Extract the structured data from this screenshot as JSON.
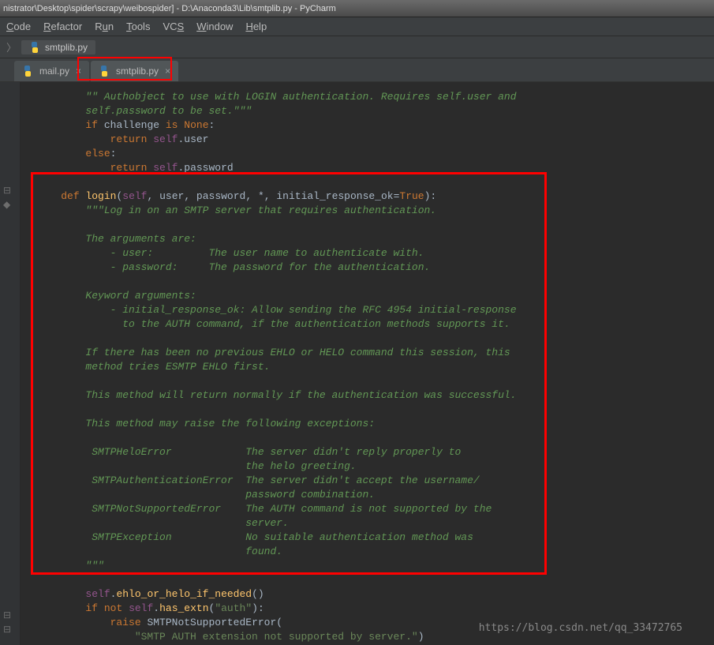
{
  "title": "nistrator\\Desktop\\spider\\scrapy\\weibospider] - D:\\Anaconda3\\Lib\\smtplib.py - PyCharm",
  "menu": {
    "code": "Code",
    "refactor": "Refactor",
    "run": "Run",
    "tools": "Tools",
    "vcs": "VCS",
    "window": "Window",
    "help": "Help"
  },
  "crumb": {
    "label": "smtplib.py",
    "arrow": "〉"
  },
  "tabs": [
    {
      "label": "mail.py"
    },
    {
      "label": "smtplib.py"
    }
  ],
  "watermark": "https://blog.csdn.net/qq_33472765",
  "code": {
    "doc1a": "\"\" Authobject to use with LOGIN authentication. Requires self.user and",
    "doc1b": "self.password to be set.\"\"\"",
    "if": "if",
    "challenge": "challenge",
    "is": "is",
    "None": "None",
    "return": "return",
    "self": "self",
    "user": "user",
    "password": "password",
    "else": "else",
    "def": "def",
    "login": "login",
    "args": "self, user, password, *, initial_response_ok=",
    "True": "True",
    "docstring": "\"\"\"Log in on an SMTP server that requires authentication.\n\nThe arguments are:\n    - user:         The user name to authenticate with.\n    - password:     The password for the authentication.\n\nKeyword arguments:\n    - initial_response_ok: Allow sending the RFC 4954 initial-response\n      to the AUTH command, if the authentication methods supports it.\n\nIf there has been no previous EHLO or HELO command this session, this\nmethod tries ESMTP EHLO first.\n\nThis method will return normally if the authentication was successful.\n\nThis method may raise the following exceptions:\n\n SMTPHeloError            The server didn't reply properly to\n                          the helo greeting.\n SMTPAuthenticationError  The server didn't accept the username/\n                          password combination.\n SMTPNotSupportedError    The AUTH command is not supported by the\n                          server.\n SMTPException            No suitable authentication method was\n                          found.\n\"\"\"",
    "ehlo_call": "ehlo_or_helo_if_needed",
    "not": "not",
    "has_extn": "has_extn",
    "auth_str": "\"auth\"",
    "raise": "raise",
    "SMTPNotSupportedError": "SMTPNotSupportedError",
    "err_str": "\"SMTP AUTH extension not supported by server.\""
  }
}
